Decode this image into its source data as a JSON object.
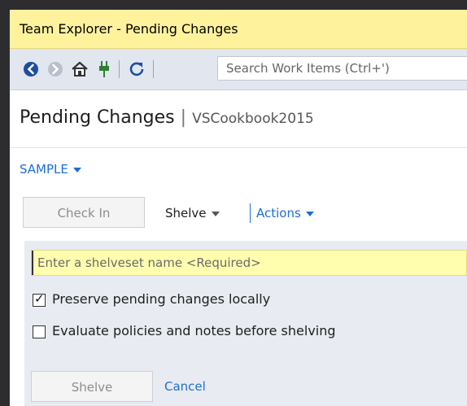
{
  "window": {
    "title": "Team Explorer - Pending Changes"
  },
  "toolbar": {
    "back_icon": "back-arrow-icon",
    "forward_icon": "forward-arrow-icon",
    "home_icon": "home-icon",
    "connect_icon": "plug-icon",
    "refresh_icon": "refresh-icon",
    "search_placeholder": "Search Work Items (Ctrl+')"
  },
  "header": {
    "title": "Pending Changes",
    "separator": "|",
    "subtitle": "VSCookbook2015"
  },
  "workspace": {
    "label": "SAMPLE"
  },
  "actions_bar": {
    "checkin_label": "Check In",
    "shelve_label": "Shelve",
    "actions_label": "Actions"
  },
  "shelve": {
    "name_placeholder": "Enter a shelveset name <Required>",
    "preserve_label": "Preserve pending changes locally",
    "preserve_checked": true,
    "evaluate_label": "Evaluate policies and notes before shelving",
    "evaluate_checked": false,
    "shelve_button": "Shelve",
    "cancel_label": "Cancel"
  },
  "colors": {
    "title_bg": "#fef29d",
    "toolbar_bg": "#e2e6ef",
    "accent": "#1e6fd0",
    "input_bg": "#fffeae",
    "panel_bg": "#e8ebf2"
  }
}
